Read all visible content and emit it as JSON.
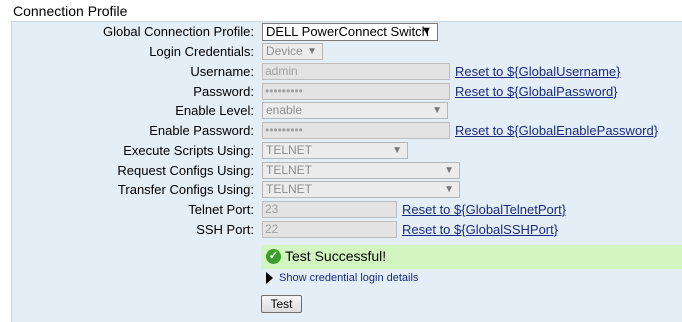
{
  "section_title": "Connection Profile",
  "fields": {
    "global_profile": {
      "label": "Global Connection Profile:",
      "value": "DELL PowerConnect Switch"
    },
    "login_credentials": {
      "label": "Login Credentials:",
      "value": "Device"
    },
    "username": {
      "label": "Username:",
      "value": "admin",
      "reset": "Reset to ${GlobalUsername}"
    },
    "password": {
      "label": "Password:",
      "value": "•••••••••",
      "reset": "Reset to ${GlobalPassword}"
    },
    "enable_level": {
      "label": "Enable Level:",
      "value": "enable"
    },
    "enable_password": {
      "label": "Enable Password:",
      "value": "•••••••••",
      "reset": "Reset to ${GlobalEnablePassword}"
    },
    "execute_scripts": {
      "label": "Execute Scripts Using:",
      "value": "TELNET"
    },
    "request_configs": {
      "label": "Request Configs Using:",
      "value": "TELNET"
    },
    "transfer_configs": {
      "label": "Transfer Configs Using:",
      "value": "TELNET"
    },
    "telnet_port": {
      "label": "Telnet Port:",
      "value": "23",
      "reset": "Reset to ${GlobalTelnetPort}"
    },
    "ssh_port": {
      "label": "SSH Port:",
      "value": "22",
      "reset": "Reset to ${GlobalSSHPort}"
    }
  },
  "status": {
    "message": "Test Successful!",
    "icon": "check-circle-icon",
    "color": "#d3f5c0"
  },
  "details_link": "Show credential login details",
  "test_button": "Test"
}
